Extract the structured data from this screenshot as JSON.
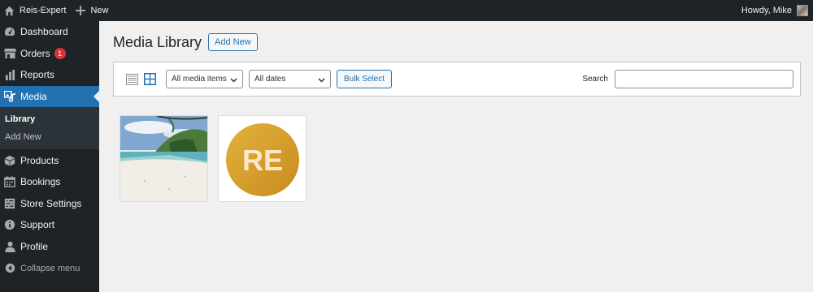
{
  "adminbar": {
    "site_name": "Reis-Expert",
    "new_label": "New",
    "greeting": "Howdy, Mike",
    "icons": [
      "home-icon",
      "plus-icon",
      "avatar"
    ]
  },
  "sidebar": {
    "items": [
      {
        "label": "Dashboard",
        "icon": "dashboard-icon"
      },
      {
        "label": "Orders",
        "icon": "store-icon",
        "badge": "1"
      },
      {
        "label": "Reports",
        "icon": "chart-bar-icon"
      },
      {
        "label": "Media",
        "icon": "media-icon",
        "active": true
      },
      {
        "label": "Products",
        "icon": "box-icon"
      },
      {
        "label": "Bookings",
        "icon": "calendar-icon"
      },
      {
        "label": "Store Settings",
        "icon": "settings-icon"
      },
      {
        "label": "Support",
        "icon": "info-icon"
      },
      {
        "label": "Profile",
        "icon": "user-icon"
      },
      {
        "label": "Collapse menu",
        "icon": "collapse-icon"
      }
    ],
    "submenu": [
      {
        "label": "Library",
        "current": true
      },
      {
        "label": "Add New"
      }
    ]
  },
  "main": {
    "title": "Media Library",
    "add_new": "Add New",
    "toolbar": {
      "filter_type": "All media items",
      "filter_date": "All dates",
      "bulk_select": "Bulk Select",
      "search_label": "Search",
      "search_value": "",
      "view_modes": [
        "list-view-icon",
        "grid-view-icon"
      ],
      "active_view": "grid"
    },
    "media": [
      {
        "kind": "photo",
        "subject": "beach"
      },
      {
        "kind": "logo",
        "text": "RE"
      }
    ]
  },
  "colors": {
    "adminbar_bg": "#1d2327",
    "accent": "#2271b1",
    "badge": "#d63638",
    "logo_gold": "#d9a02a"
  }
}
